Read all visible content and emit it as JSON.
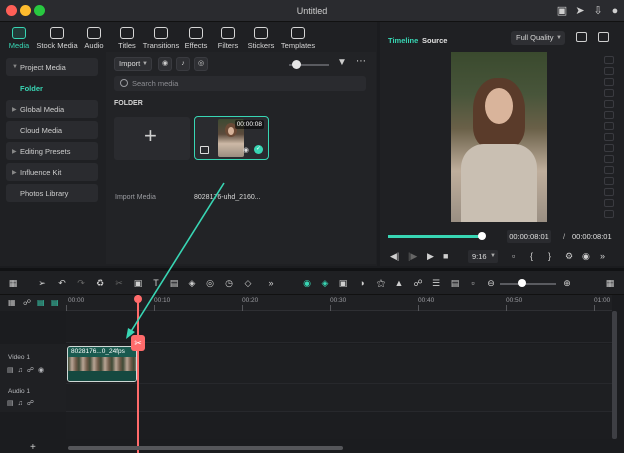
{
  "window": {
    "title": "Untitled"
  },
  "toolbar": {
    "tabs": [
      {
        "label": "Media",
        "icon": "media-icon",
        "active": true
      },
      {
        "label": "Stock Media",
        "icon": "stock-media-icon"
      },
      {
        "label": "Audio",
        "icon": "music-note-icon"
      },
      {
        "label": "Titles",
        "icon": "text-t-icon"
      },
      {
        "label": "Transitions",
        "icon": "transitions-icon"
      },
      {
        "label": "Effects",
        "icon": "effects-icon"
      },
      {
        "label": "Filters",
        "icon": "filters-icon"
      },
      {
        "label": "Stickers",
        "icon": "stickers-icon"
      },
      {
        "label": "Templates",
        "icon": "templates-icon"
      }
    ]
  },
  "sidebar": {
    "items": [
      {
        "label": "Project Media",
        "expanded": true
      },
      {
        "label": "Folder",
        "selected": true
      },
      {
        "label": "Global Media"
      },
      {
        "label": "Cloud Media"
      },
      {
        "label": "Editing Presets"
      },
      {
        "label": "Influence Kit"
      },
      {
        "label": "Photos Library"
      }
    ]
  },
  "media": {
    "import_label": "Import",
    "search_placeholder": "Search media",
    "folder_heading": "FOLDER",
    "import_tile_label": "Import Media",
    "clip": {
      "duration": "00:00:08",
      "name": "8028176-uhd_2160..."
    }
  },
  "player": {
    "tab_timeline": "Timeline",
    "tab_source": "Source",
    "quality": "Full Quality",
    "current_time": "00:00:08:01",
    "separator": "/",
    "total_time": "00:00:08:01",
    "aspect_ratio": "9:16",
    "progress_fraction": 0.98
  },
  "timeline": {
    "ruler_ticks": [
      "00:00",
      "00:10",
      "00:20",
      "00:30",
      "00:40",
      "00:50",
      "01:00"
    ],
    "tracks": [
      {
        "label": "Video 1"
      },
      {
        "label": "Audio 1"
      }
    ],
    "clip_label": "8028176...0_24fps",
    "zoom_level_fraction": 0.4
  },
  "colors": {
    "accent": "#38d6b4",
    "playhead": "#ff6b6b",
    "background": "#1b1c1f"
  }
}
